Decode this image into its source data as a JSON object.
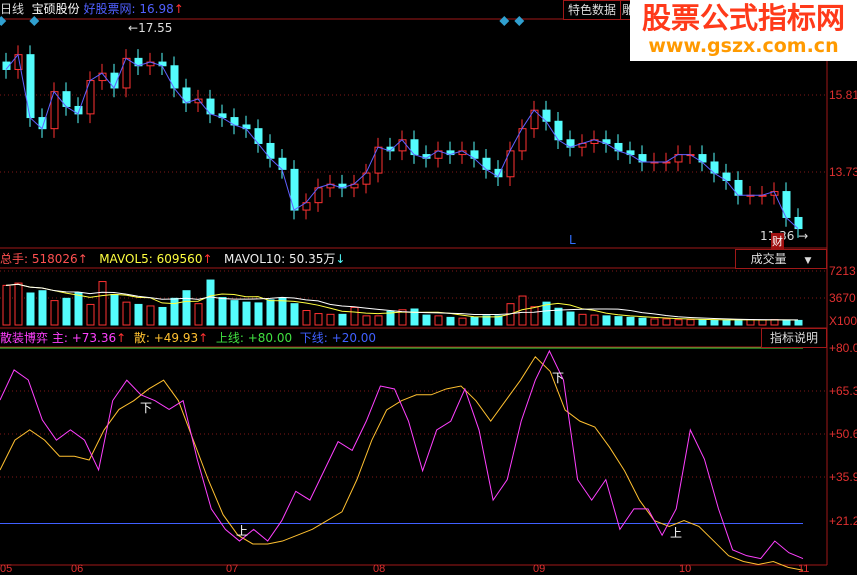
{
  "header": {
    "period": "日线",
    "stock_name": "宝硕股份",
    "site_label": "好股票网:",
    "price": "16.98",
    "price_arrow": "↑"
  },
  "tabs": {
    "feature_data": "特色数据",
    "partial_tab": "雕"
  },
  "watermark": {
    "title": "股票公式指标网",
    "url": "www.gszx.com.cn"
  },
  "price_panel": {
    "axis_labels": [
      "15.81",
      "13.73"
    ],
    "high_label": "17.55",
    "low_label": "11.36",
    "finance_badge": "财",
    "marker_L": "L",
    "closes": [
      16.5,
      16.9,
      15.2,
      14.9,
      15.9,
      15.5,
      15.3,
      16.2,
      16.4,
      16.0,
      16.8,
      16.6,
      16.7,
      16.6,
      16.0,
      15.6,
      15.7,
      15.3,
      15.2,
      15.0,
      14.9,
      14.5,
      14.1,
      13.8,
      12.7,
      12.9,
      13.3,
      13.4,
      13.3,
      13.4,
      13.7,
      14.4,
      14.3,
      14.6,
      14.2,
      14.1,
      14.3,
      14.2,
      14.3,
      14.1,
      13.8,
      13.6,
      14.3,
      14.9,
      15.4,
      15.1,
      14.6,
      14.4,
      14.5,
      14.6,
      14.5,
      14.3,
      14.2,
      14.0,
      14.0,
      14.0,
      14.2,
      14.2,
      14.0,
      13.7,
      13.5,
      13.1,
      13.1,
      13.1,
      13.2,
      12.5,
      12.2
    ],
    "colors": {
      "up": "#ff3232",
      "down": "#54fcfc",
      "ma": "#6060ff"
    }
  },
  "volume_panel": {
    "total_label": "总手:",
    "total_value": "518026",
    "total_arrow": "↑",
    "ma5_label": "MAVOL5:",
    "ma5_value": "609560",
    "ma5_arrow": "↑",
    "ma10_label": "MAVOL10:",
    "ma10_value": "50.35万",
    "ma10_arrow": "↓",
    "indicator_select": "成交量",
    "axis_labels": [
      "7213",
      "3670",
      "X100"
    ],
    "volumes": [
      5200,
      5500,
      4200,
      4500,
      3200,
      3500,
      4200,
      2700,
      5700,
      4000,
      3000,
      2700,
      2500,
      2300,
      3500,
      4500,
      2800,
      5900,
      3600,
      3200,
      3000,
      2900,
      3300,
      3500,
      2800,
      1900,
      1500,
      1400,
      1400,
      2300,
      1200,
      1200,
      1800,
      2000,
      2100,
      1300,
      1200,
      1000,
      900,
      1000,
      1200,
      1200,
      2800,
      3800,
      2400,
      3000,
      2200,
      1700,
      1400,
      1300,
      1200,
      1100,
      1000,
      900,
      800,
      800,
      700,
      700,
      700,
      650,
      650,
      650,
      700,
      650,
      700,
      650,
      600
    ]
  },
  "indicator_panel": {
    "name": "散装博弈",
    "main_label": "主:",
    "main_value": "+73.36",
    "main_arrow": "↑",
    "retail_label": "散:",
    "retail_value": "+49.93",
    "retail_arrow": "↑",
    "upper_label": "上线:",
    "upper_value": "+80.00",
    "lower_label": "下线:",
    "lower_value": "+20.00",
    "explain_button": "指标说明",
    "axis_labels": [
      "+80.0",
      "+65.3",
      "+50.6",
      "+35.9",
      "+21.2"
    ],
    "upper": 80,
    "lower": 20,
    "main": [
      62.2,
      72.5,
      69.1,
      55.4,
      48.5,
      52.0,
      48.5,
      38.3,
      62,
      69,
      64,
      62,
      59,
      62,
      42,
      25,
      18,
      14,
      18,
      14,
      21,
      31,
      28,
      38,
      48,
      45,
      55,
      67,
      66,
      55,
      38,
      52,
      55,
      66,
      52,
      28,
      35,
      55,
      69,
      79,
      69,
      35,
      28,
      35,
      18,
      25,
      25,
      16,
      25,
      52,
      42,
      25,
      11,
      9,
      8,
      14,
      10,
      8
    ],
    "retail": [
      38.3,
      48.5,
      52,
      48.5,
      43,
      43,
      41.7,
      52,
      59,
      62,
      66,
      69,
      62,
      48.5,
      35,
      23,
      16,
      13,
      13,
      14,
      16,
      18,
      21,
      24,
      35,
      48.5,
      58.8,
      62,
      64,
      64,
      66,
      67,
      62,
      55,
      62,
      69,
      77,
      72,
      58.8,
      55,
      53,
      46,
      38,
      28,
      21,
      19,
      21,
      19,
      14,
      9,
      7,
      6,
      7,
      5,
      4
    ]
  },
  "dates": [
    "05",
    "06",
    "07",
    "08",
    "09",
    "10",
    "11"
  ]
}
